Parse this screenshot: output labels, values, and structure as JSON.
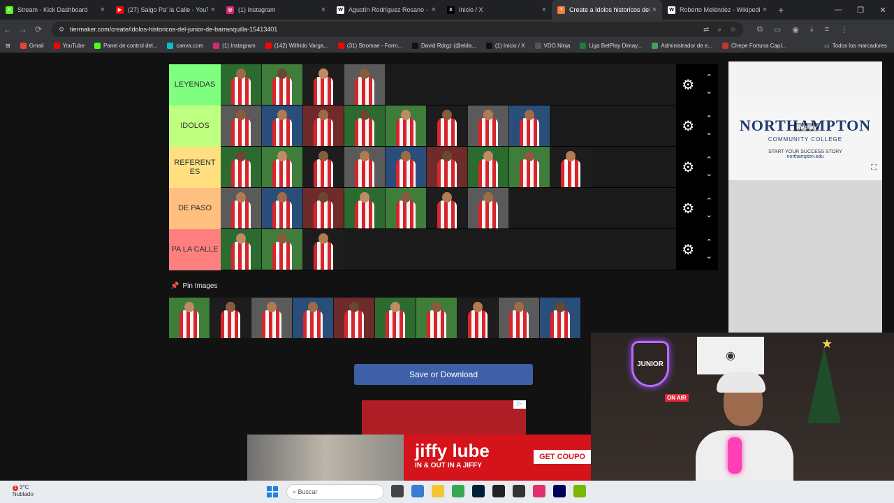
{
  "tabs": [
    {
      "title": "Stream - Kick Dashboard",
      "color": "#53fc18",
      "glyph": "K"
    },
    {
      "title": "(27) Salgo Pa' la Calle - YouTub",
      "color": "#ff0000",
      "glyph": "▶"
    },
    {
      "title": "(1) Instagram",
      "color": "#d62976",
      "glyph": "◎"
    },
    {
      "title": "Agustín Rodríguez Rosano - W",
      "color": "#ffffff",
      "glyph": "W"
    },
    {
      "title": "Inicio / X",
      "color": "#000000",
      "glyph": "X"
    },
    {
      "title": "Create a Idolos historicos del ju",
      "color": "#ff7a3d",
      "glyph": "T",
      "active": true
    },
    {
      "title": "Roberto Meléndez - Wikipedia",
      "color": "#ffffff",
      "glyph": "W"
    }
  ],
  "address": {
    "url": "tiermaker.com/create/idolos-historicos-del-junior-de-barranquilla-15413401"
  },
  "bookmarks": [
    {
      "label": "Gmail",
      "color": "#ea4335"
    },
    {
      "label": "YouTube",
      "color": "#ff0000"
    },
    {
      "label": "Panel de control del...",
      "color": "#53fc18"
    },
    {
      "label": "canva.com",
      "color": "#00c4cc"
    },
    {
      "label": "(1) Instagram",
      "color": "#d62976"
    },
    {
      "label": "(142) Wilfrido Varga...",
      "color": "#ff0000"
    },
    {
      "label": "(31) Stromae - Form...",
      "color": "#ff0000"
    },
    {
      "label": "David Rdrgz (@elda...",
      "color": "#111111"
    },
    {
      "label": "(1) Inicio / X",
      "color": "#111111"
    },
    {
      "label": "VDO.Ninja",
      "color": "#555555"
    },
    {
      "label": "Liga BetPlay Dimay...",
      "color": "#1a7f3c"
    },
    {
      "label": "Administrador de e...",
      "color": "#3ba55d"
    },
    {
      "label": "Chepe Fortuna Capí...",
      "color": "#c0392b"
    }
  ],
  "bookmarks_all": "Todos los marcadores",
  "tiers": [
    {
      "label": "LEYENDAS",
      "color": "#7fff7f",
      "count": 4
    },
    {
      "label": "IDOLOS",
      "color": "#bfff7f",
      "count": 8
    },
    {
      "label": "REFERENT ES",
      "color": "#ffdf7f",
      "count": 9
    },
    {
      "label": "DE PASO",
      "color": "#ffbf7f",
      "count": 7
    },
    {
      "label": "PA LA CALLE",
      "color": "#ff7f7f",
      "count": 3
    }
  ],
  "pin_label": "Pin Images",
  "pool_count": 10,
  "save_button": "Save or Download",
  "side_ad": {
    "logo": "NORTHAMPTON",
    "sub": "COMMUNITY COLLEGE",
    "tagline": "START YOUR SUCCESS STORY",
    "url": "northampton.edu",
    "replay": "Replay"
  },
  "cam": {
    "neon": "JUNIOR",
    "onair": "ON AIR"
  },
  "jiffy": {
    "brand": "jiffy lube",
    "sub": "IN & OUT IN A JIFFY",
    "cta": "GET COUPO"
  },
  "taskbar": {
    "temp": "3°C",
    "weather": "Nublado",
    "search": "Buscar"
  }
}
